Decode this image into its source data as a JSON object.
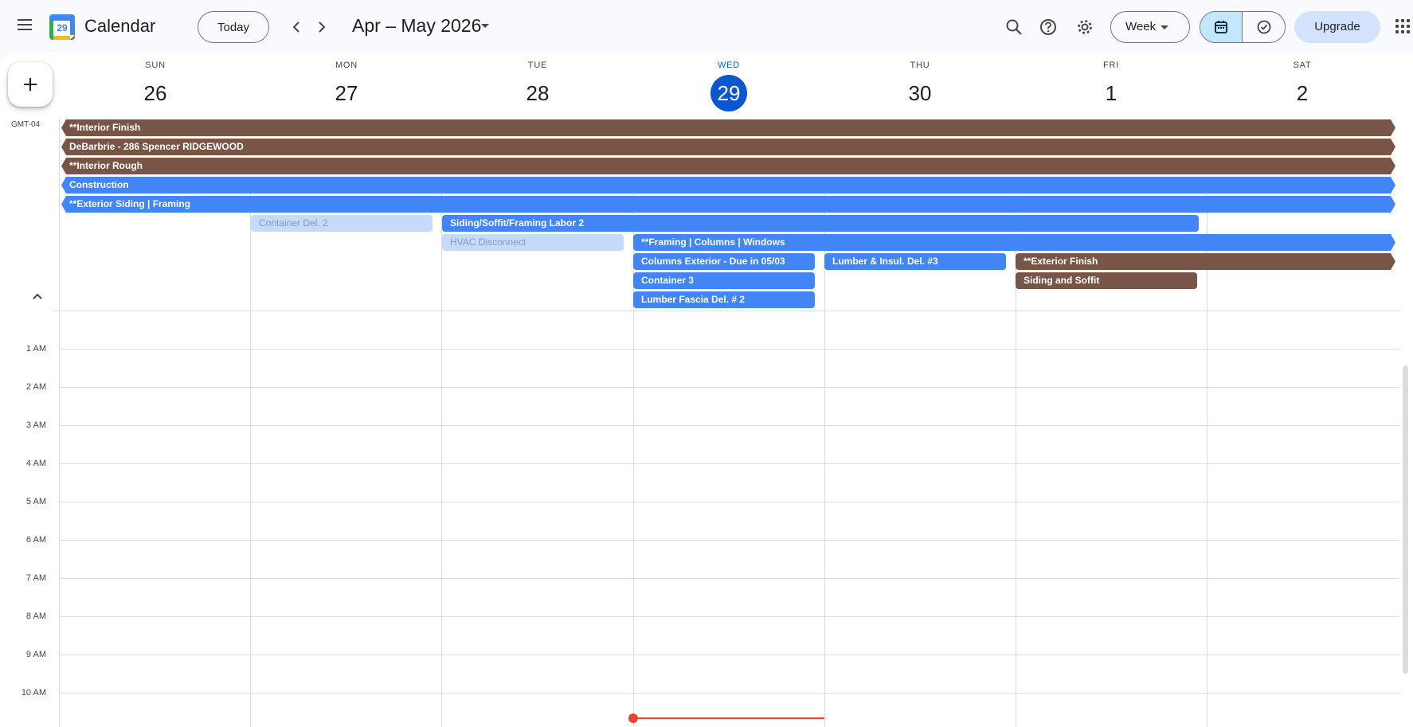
{
  "header": {
    "app_title": "Calendar",
    "logo_day": "29",
    "today_label": "Today",
    "date_range": "Apr – May 2026",
    "view_label": "Week",
    "upgrade_label": "Upgrade"
  },
  "icons": {
    "menu": "menu-icon",
    "prev": "chevron-left-icon",
    "next": "chevron-right-icon",
    "search": "search-icon",
    "help": "help-icon",
    "settings": "gear-icon",
    "calendar_view": "calendar-icon",
    "tasks_view": "check-circle-icon",
    "apps": "apps-grid-icon",
    "create": "plus-icon"
  },
  "colors": {
    "brand_blue": "#0b57d0",
    "event_blue": "#4285f4",
    "event_brown": "#795548",
    "event_pale": "#c6dafc",
    "now_line": "#ea4335",
    "toggle_active": "#c2e7ff",
    "upgrade_bg": "#d3e3fd"
  },
  "timezone": "GMT-04",
  "days": [
    {
      "dow": "SUN",
      "num": "26"
    },
    {
      "dow": "MON",
      "num": "27"
    },
    {
      "dow": "TUE",
      "num": "28"
    },
    {
      "dow": "WED",
      "num": "29",
      "today": true
    },
    {
      "dow": "THU",
      "num": "30"
    },
    {
      "dow": "FRI",
      "num": "1"
    },
    {
      "dow": "SAT",
      "num": "2"
    }
  ],
  "events": [
    {
      "title": "**Interior Finish",
      "color": "brown"
    },
    {
      "title": "DeBarbrie - 286 Spencer RIDGEWOOD",
      "color": "brown"
    },
    {
      "title": "**Interior Rough",
      "color": "brown"
    },
    {
      "title": "Construction",
      "color": "blue"
    },
    {
      "title": "**Exterior Siding | Framing",
      "color": "blue"
    },
    {
      "title": "Container Del. 2",
      "color": "pale"
    },
    {
      "title": "Siding/Soffit/Framing Labor 2",
      "color": "blue"
    },
    {
      "title": "HVAC Disconnect",
      "color": "pale"
    },
    {
      "title": "**Framing | Columns | Windows",
      "color": "blue"
    },
    {
      "title": "Columns Exterior - Due in 05/03",
      "color": "blue"
    },
    {
      "title": "Lumber & Insul. Del. #3",
      "color": "blue"
    },
    {
      "title": "**Exterior Finish",
      "color": "brown"
    },
    {
      "title": "Container 3",
      "color": "blue"
    },
    {
      "title": "Siding and Soffit",
      "color": "brown"
    },
    {
      "title": "Lumber Fascia Del. # 2",
      "color": "blue"
    }
  ],
  "hours": [
    "1 AM",
    "2 AM",
    "3 AM",
    "4 AM",
    "5 AM",
    "6 AM",
    "7 AM",
    "8 AM",
    "9 AM",
    "10 AM"
  ]
}
